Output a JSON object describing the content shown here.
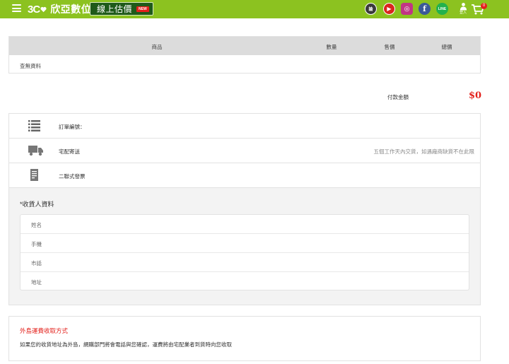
{
  "header": {
    "logo_mark": "3C",
    "logo_text": "欣亞數位",
    "estimate_label": "線上估價",
    "estimate_badge": "NEW",
    "social": {
      "forum": "論",
      "youtube": "▶",
      "instagram": "◎",
      "facebook": "f",
      "line": "LINE"
    },
    "login_label": "登入",
    "cart_count": "0",
    "icons": [
      "menu-icon",
      "heart-icon",
      "forum-icon",
      "youtube-icon",
      "instagram-icon",
      "facebook-icon",
      "line-icon",
      "user-icon",
      "cart-icon"
    ],
    "colors": {
      "bar": "#8cc220",
      "estimate_bg": "#1f5a1a",
      "badge": "#e3201b"
    }
  },
  "cart": {
    "columns": {
      "product": "商品",
      "quantity": "數量",
      "price": "售價",
      "total": "總價"
    },
    "empty_text": "查無資料"
  },
  "summary": {
    "total_label": "付款金額",
    "total_value": "$0"
  },
  "order": {
    "order_number_label": "訂單編號：",
    "shipping_label": "宅配寄送",
    "shipping_note": "五個工作天內交貨，如遇廠商缺貨不在此限",
    "invoice_label": "二聯式發票",
    "icons": [
      "list-icon",
      "truck-icon",
      "invoice-icon"
    ]
  },
  "receiver": {
    "title": "*收貨人資料",
    "fields": {
      "name": "姓名",
      "mobile": "手機",
      "phone": "市話",
      "address": "地址"
    }
  },
  "island": {
    "title": "外島運費收取方式",
    "text": "如果您的收貨地址為外島，網購部門將會電話與您確認，運費將由宅配業者到貨時向您收取"
  }
}
